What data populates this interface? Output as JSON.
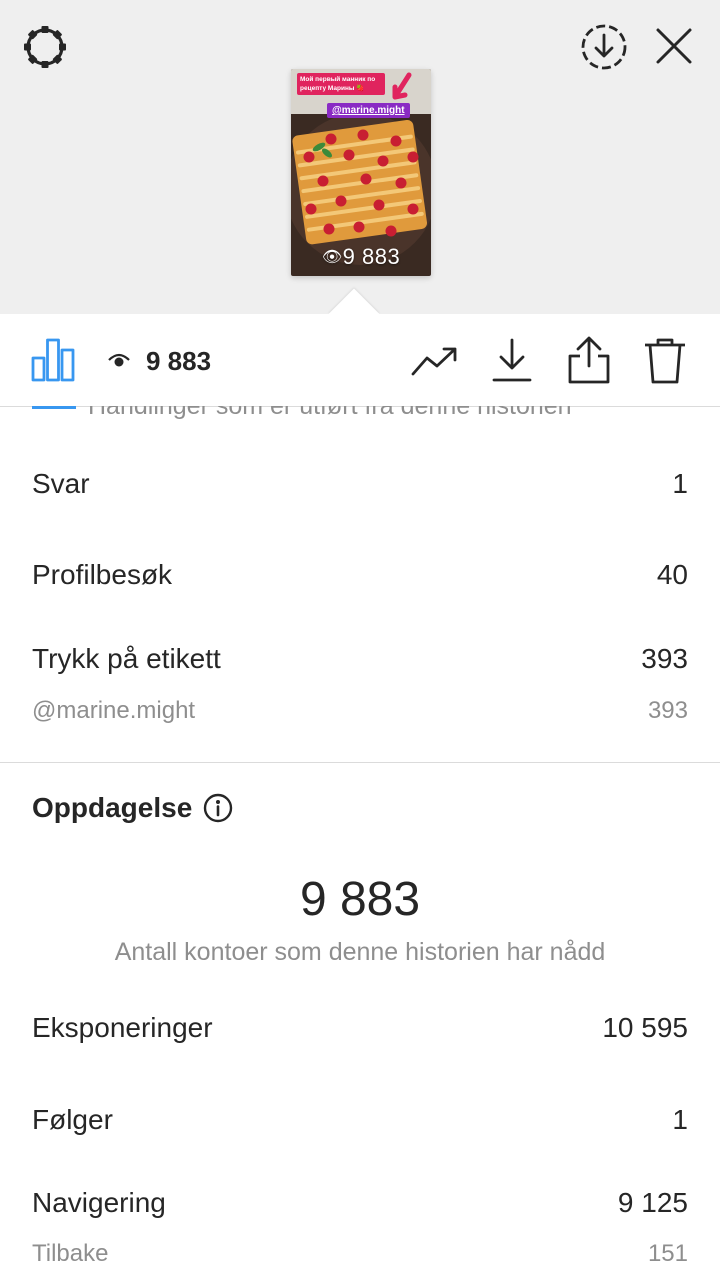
{
  "header": {
    "settings_icon": "gear-icon",
    "download_icon": "download-circle-icon",
    "close_icon": "close-icon"
  },
  "story": {
    "caption": "Мой первый манник по рецепту Марины 🍓",
    "mention": "@marine.might",
    "view_count": "9 883"
  },
  "toolbar": {
    "views_count": "9 883",
    "icons": [
      "bar-chart-icon",
      "eye-icon",
      "trending-up-icon",
      "download-icon",
      "share-icon",
      "trash-icon"
    ],
    "accent_color": "#3897f0"
  },
  "interactions": {
    "clipped_header": "Handlinger som er utført fra denne historien",
    "rows": [
      {
        "label": "Svar",
        "value": "1"
      },
      {
        "label": "Profilbesøk",
        "value": "40"
      },
      {
        "label": "Trykk på etikett",
        "value": "393"
      }
    ],
    "sticker_row": {
      "label": "@marine.might",
      "value": "393"
    }
  },
  "discovery": {
    "title": "Oppdagelse",
    "reach_value": "9 883",
    "reach_caption": "Antall kontoer som denne historien har nådd",
    "rows": [
      {
        "label": "Eksponeringer",
        "value": "10 595"
      },
      {
        "label": "Følger",
        "value": "1"
      },
      {
        "label": "Navigering",
        "value": "9 125"
      }
    ],
    "sub_row": {
      "label": "Tilbake",
      "value": "151"
    }
  }
}
